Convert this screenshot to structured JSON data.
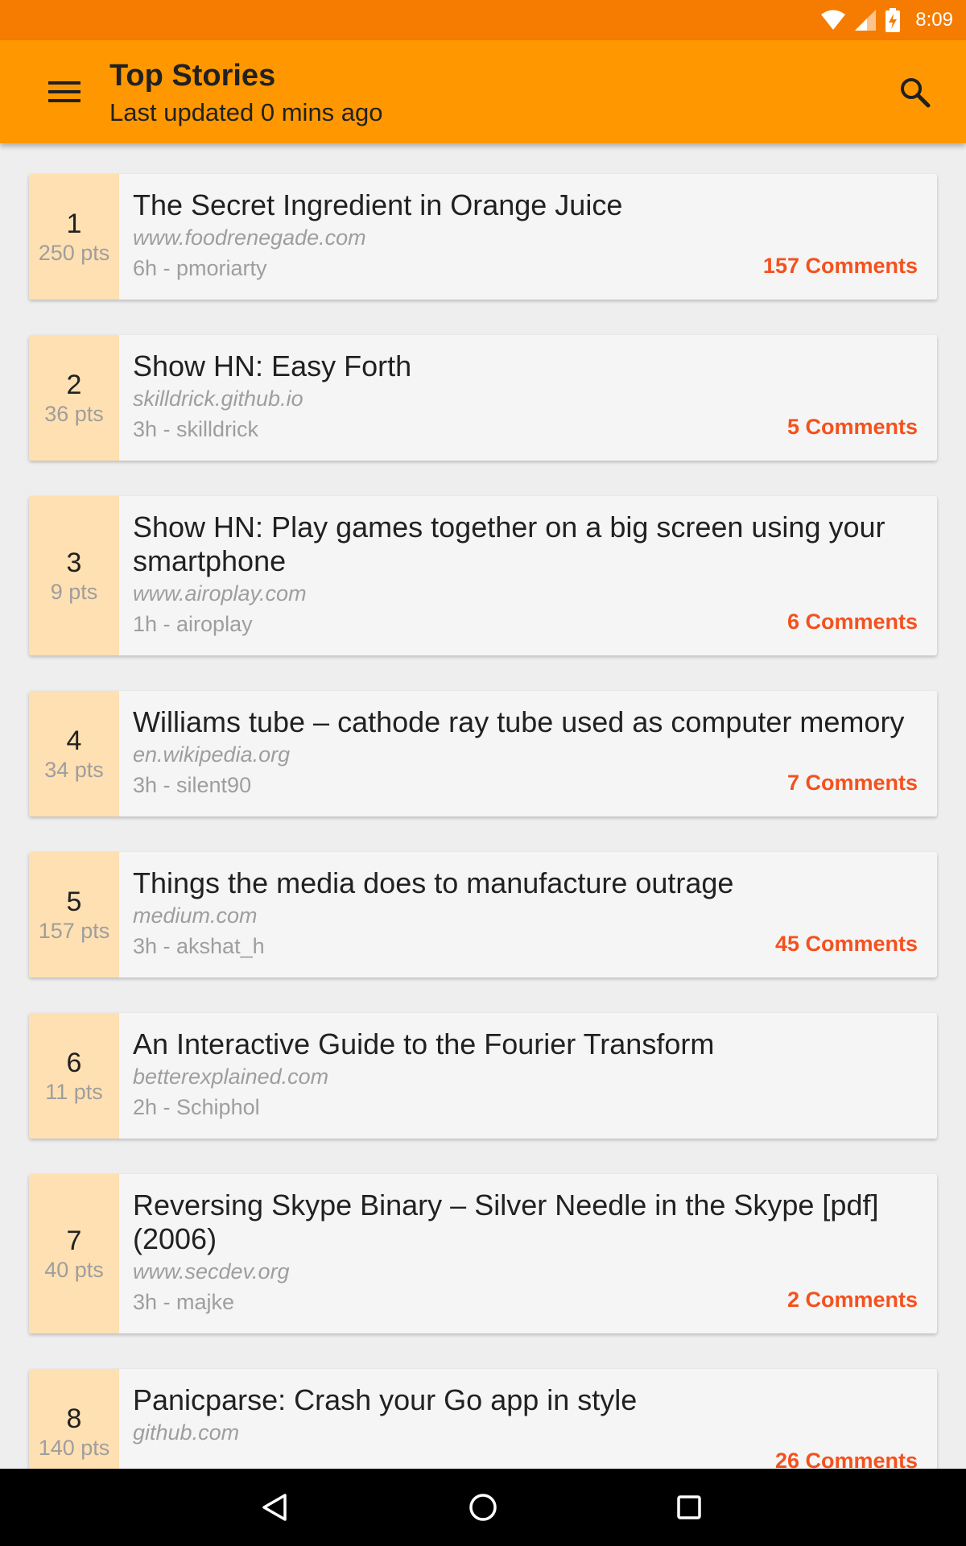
{
  "status_bar": {
    "time": "8:09",
    "icons": [
      "wifi-icon",
      "cell-signal-icon",
      "battery-charging-icon"
    ]
  },
  "app_bar": {
    "title": "Top Stories",
    "subtitle": "Last updated 0 mins ago",
    "menu_icon": "hamburger-menu-icon",
    "search_icon": "search-icon",
    "background": "#ff9800"
  },
  "stories": [
    {
      "rank": "1",
      "points": "250 pts",
      "title": "The Secret Ingredient in Orange Juice",
      "domain": "www.foodrenegade.com",
      "meta": "6h - pmoriarty",
      "comments": "157 Comments"
    },
    {
      "rank": "2",
      "points": "36 pts",
      "title": "Show HN: Easy Forth",
      "domain": "skilldrick.github.io",
      "meta": "3h - skilldrick",
      "comments": "5 Comments"
    },
    {
      "rank": "3",
      "points": "9 pts",
      "title": "Show HN: Play games together on a big screen using your smartphone",
      "domain": "www.airoplay.com",
      "meta": "1h - airoplay",
      "comments": "6 Comments"
    },
    {
      "rank": "4",
      "points": "34 pts",
      "title": "Williams tube – cathode ray tube used as computer memory",
      "domain": "en.wikipedia.org",
      "meta": "3h - silent90",
      "comments": "7 Comments"
    },
    {
      "rank": "5",
      "points": "157 pts",
      "title": "Things the media does to manufacture outrage",
      "domain": "medium.com",
      "meta": "3h - akshat_h",
      "comments": "45 Comments"
    },
    {
      "rank": "6",
      "points": "11 pts",
      "title": "An Interactive Guide to the Fourier Transform",
      "domain": "betterexplained.com",
      "meta": "2h - Schiphol",
      "comments": ""
    },
    {
      "rank": "7",
      "points": "40 pts",
      "title": "Reversing Skype Binary – Silver Needle in the Skype [pdf] (2006)",
      "domain": "www.secdev.org",
      "meta": "3h - majke",
      "comments": "2 Comments"
    },
    {
      "rank": "8",
      "points": "140 pts",
      "title": "Panicparse: Crash your Go app in style",
      "domain": "github.com",
      "meta": "",
      "comments": "26 Comments"
    }
  ],
  "nav_bar": {
    "buttons": [
      "back-icon",
      "home-icon",
      "recents-icon"
    ]
  },
  "colors": {
    "status_bar": "#f57c00",
    "rank_background": "#ffe0b2",
    "comments": "#f4511e"
  }
}
